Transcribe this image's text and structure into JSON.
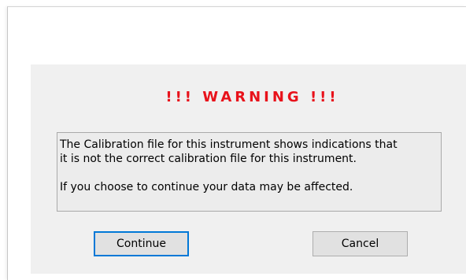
{
  "dialog": {
    "title": "!!! WARNING !!!",
    "title_color": "#e8121b",
    "message": {
      "line1": "The Calibration file for this instrument shows indications that",
      "line2": "it is not the correct calibration file for this instrument.",
      "line3": "If you choose to continue your data may be affected."
    },
    "buttons": {
      "continue_label": "Continue",
      "cancel_label": "Cancel"
    },
    "focus_color": "#0078d7"
  }
}
